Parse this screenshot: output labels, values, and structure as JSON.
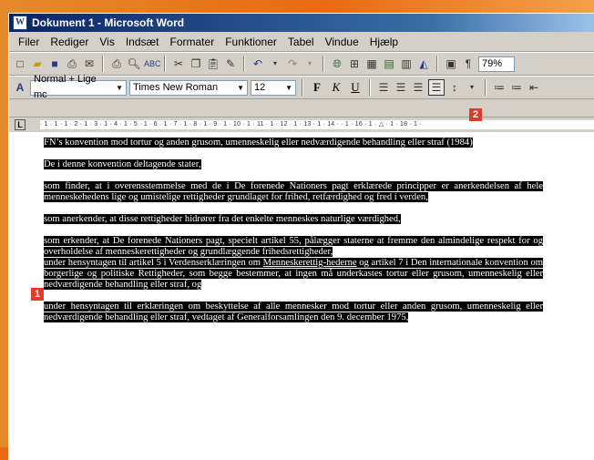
{
  "window": {
    "title": "Dokument 1 - Microsoft Word"
  },
  "menu": [
    "Filer",
    "Rediger",
    "Vis",
    "Indsæt",
    "Formater",
    "Funktioner",
    "Tabel",
    "Vindue",
    "Hjælp"
  ],
  "toolbar": {
    "zoom": "79%",
    "pilcrow": "¶"
  },
  "format": {
    "style": "Normal + Lige mc",
    "font": "Times New Roman",
    "size": "12",
    "bold": "F",
    "italic": "K",
    "underline": "U"
  },
  "ruler": {
    "text": "· 1 · 1 · 1 · 2 · 1 · 3 · 1 · 4 · 1 · 5 · 1 · 6 · 1 · 7 · 1 · 8 · 1 · 9 · 1 · 10 · 1 · 11 · 1 · 12 · 1 · 13 · 1 · 14 ·      · 1 · 16 · 1 · △ · 1 · 18 · 1 ·"
  },
  "badges": {
    "one": "1",
    "two": "2"
  },
  "document": {
    "p1": "FN’s konvention mod tortur og anden grusom, umenneskelig eller nedværdigende behandling eller straf (1984)",
    "p2": "De i denne konvention deltagende stater,",
    "p3": "som finder, at i overensstemmelse med de i De forenede Nationers pagt erklærede principper er anerkendelsen af hele menneskehedens lige og umistelige rettigheder grundlaget for frihed, retfærdighed og fred i verden,",
    "p4": "som anerkender, at disse rettigheder hidrører fra det enkelte menneskes naturlige værdighed,",
    "p5": "som erkender, at De forenede Nationers pagt, specielt artikel 55, pålægger staterne at fremme den almindelige respekt for og overholdelse af menneskerettigheder og grundlæggende frihedsrettigheder,",
    "p6a": "under hensyntagen til artikel 5 i Verdenserklæringen om ",
    "p6link": "Menneskerettig-hederne",
    "p6b": " og artikel 7 i Den internationale konvention om borgerlige og politiske Rettigheder, som begge bestemmer, at ingen må underkastes tortur eller grusom, umenneskelig eller nedværdigende behandling eller straf, og",
    "p7": "under hensyntagen til erklæringen om beskyttelse af alle mennesker mod tortur eller anden grusom, umenneskelig eller nedværdigende behandling eller straf, vedtaget af Generalforsamlingen den 9. december 1975,"
  }
}
